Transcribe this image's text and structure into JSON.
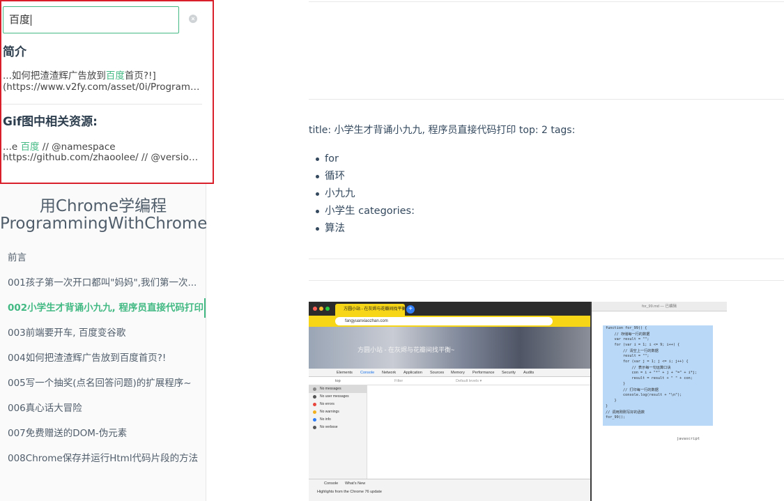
{
  "search": {
    "value": "百度",
    "groups": [
      {
        "title": "简介",
        "line1_pre": "...如何把渣渣辉广告放到",
        "line1_hl": "百度",
        "line1_post": "首页?!]",
        "line2": "(https://www.v2fy.com/asset/0i/Programming..."
      },
      {
        "title": "Gif图中相关资源:",
        "line1_pre": "...e ",
        "line1_hl": "百度",
        "line1_post": " // @namespace",
        "line2": "https://github.com/zhaoolee/ // @version ..."
      }
    ]
  },
  "app": {
    "title_line1": "用Chrome学编程",
    "title_line2": "ProgrammingWithChrome"
  },
  "nav": {
    "items": [
      "前言",
      "001孩子第一次开口都叫\"妈妈\",我们第一次...",
      "002小学生才背诵小九九, 程序员直接代码打印",
      "003前端要开车, 百度变谷歌",
      "004如何把渣渣辉广告放到百度首页?!",
      "005写一个抽奖(点名回答问题)的扩展程序~",
      "006真心话大冒险",
      "007免费赠送的DOM-伪元素",
      "008Chrome保存并运行Html代码片段的方法"
    ],
    "active_index": 2
  },
  "content": {
    "meta": "title: 小学生才背诵小九九, 程序员直接代码打印 top: 2 tags:",
    "tags": [
      "for",
      "循环",
      "小九九",
      "小学生 categories:",
      "算法"
    ]
  },
  "screenshot": {
    "tab_title": "方圆小站 - 在灰烬与花瓣间找平衡~",
    "address": "fangyuanxiaozhan.com",
    "banner_text": "方圆小站 - 在灰烬与花瓣间找平衡~",
    "devtools_tabs": [
      "Elements",
      "Console",
      "Network",
      "Application",
      "Sources",
      "Memory",
      "Performance",
      "Security",
      "Audits"
    ],
    "context": "top",
    "filter_placeholder": "Filter",
    "levels": "Default levels ▾",
    "messages": [
      {
        "label": "No messages",
        "color": "#888888"
      },
      {
        "label": "No user messages",
        "color": "#555555"
      },
      {
        "label": "No errors",
        "color": "#e8453c"
      },
      {
        "label": "No warnings",
        "color": "#f2b01e"
      },
      {
        "label": "No info",
        "color": "#2e7cf6"
      },
      {
        "label": "No verbose",
        "color": "#555555"
      }
    ],
    "drawer_tabs": [
      "Console",
      "What's New"
    ],
    "drawer_text": "Highlights from the Chrome 76 update",
    "editor_title": "for_99.md — 已编辑",
    "code": [
      "function for_99() {",
      "    // 存储每一行的数据",
      "    var result = \"\";",
      "    for (var i = 1; i <= 9; i++) {",
      "        // 清空上一行的数据",
      "        result = \"\";",
      "        for (var j = 1; j <= i; j++) {",
      "            // 表示每一句运算口诀",
      "            con = i + \"*\" + j + \"=\" + i*j;",
      "            result = result + \" \" + con;",
      "        }",
      "        // 打印每一行的数据",
      "        console.log(result + \"\\n\");",
      "    }",
      "}",
      "// 调用刚刚写好的函数",
      "for_99();"
    ],
    "language": "javascript"
  },
  "colors": {
    "accent": "#42b983",
    "highlight_border": "#d9202a"
  }
}
